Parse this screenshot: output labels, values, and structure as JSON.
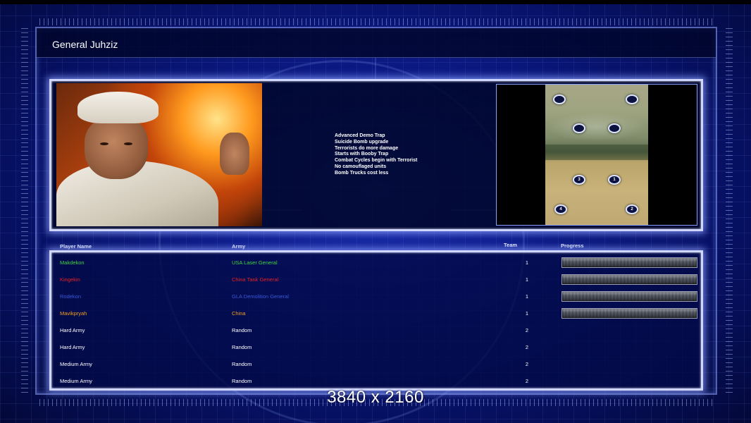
{
  "top_strip": {
    "left_text": "",
    "right_text": ""
  },
  "general": {
    "title": "General Juhziz"
  },
  "features": [
    "Advanced Demo Trap",
    "Suicide Bomb upgrade",
    "Terrorists do more damage",
    "Starts with Booby Trap",
    "Combat Cycles begin with Terrorist",
    "No camouflaged units",
    "Bomb Trucks cost less"
  ],
  "map": {
    "spawns": [
      {
        "label": ""
      },
      {
        "label": ""
      },
      {
        "label": ""
      },
      {
        "label": ""
      },
      {
        "label": "3"
      },
      {
        "label": "1"
      },
      {
        "label": "4"
      },
      {
        "label": "2"
      }
    ]
  },
  "table": {
    "headers": {
      "name": "Player Name",
      "army": "Army",
      "team": "Team",
      "progress": "Progress"
    },
    "rows": [
      {
        "name": "Makdekon",
        "army": "USA Laser General",
        "team": "1",
        "color": "#3fd43f",
        "progress": 1.0
      },
      {
        "name": "Kingekin",
        "army": "China Tank General",
        "team": "1",
        "color": "#e82020",
        "progress": 1.0
      },
      {
        "name": "Rodekon",
        "army": "GLA Demolition General",
        "team": "1",
        "color": "#3a58d8",
        "progress": 1.0
      },
      {
        "name": "Mavikpryah",
        "army": "China",
        "team": "1",
        "color": "#f0a020",
        "progress": 1.0
      },
      {
        "name": "Hard Army",
        "army": "Random",
        "team": "2",
        "color": "#ffffff"
      },
      {
        "name": "Hard Army",
        "army": "Random",
        "team": "2",
        "color": "#ffffff"
      },
      {
        "name": "Medium Army",
        "army": "Random",
        "team": "2",
        "color": "#ffffff"
      },
      {
        "name": "Medium Army",
        "army": "Random",
        "team": "2",
        "color": "#ffffff"
      }
    ]
  },
  "watermark": "3840 x 2160"
}
